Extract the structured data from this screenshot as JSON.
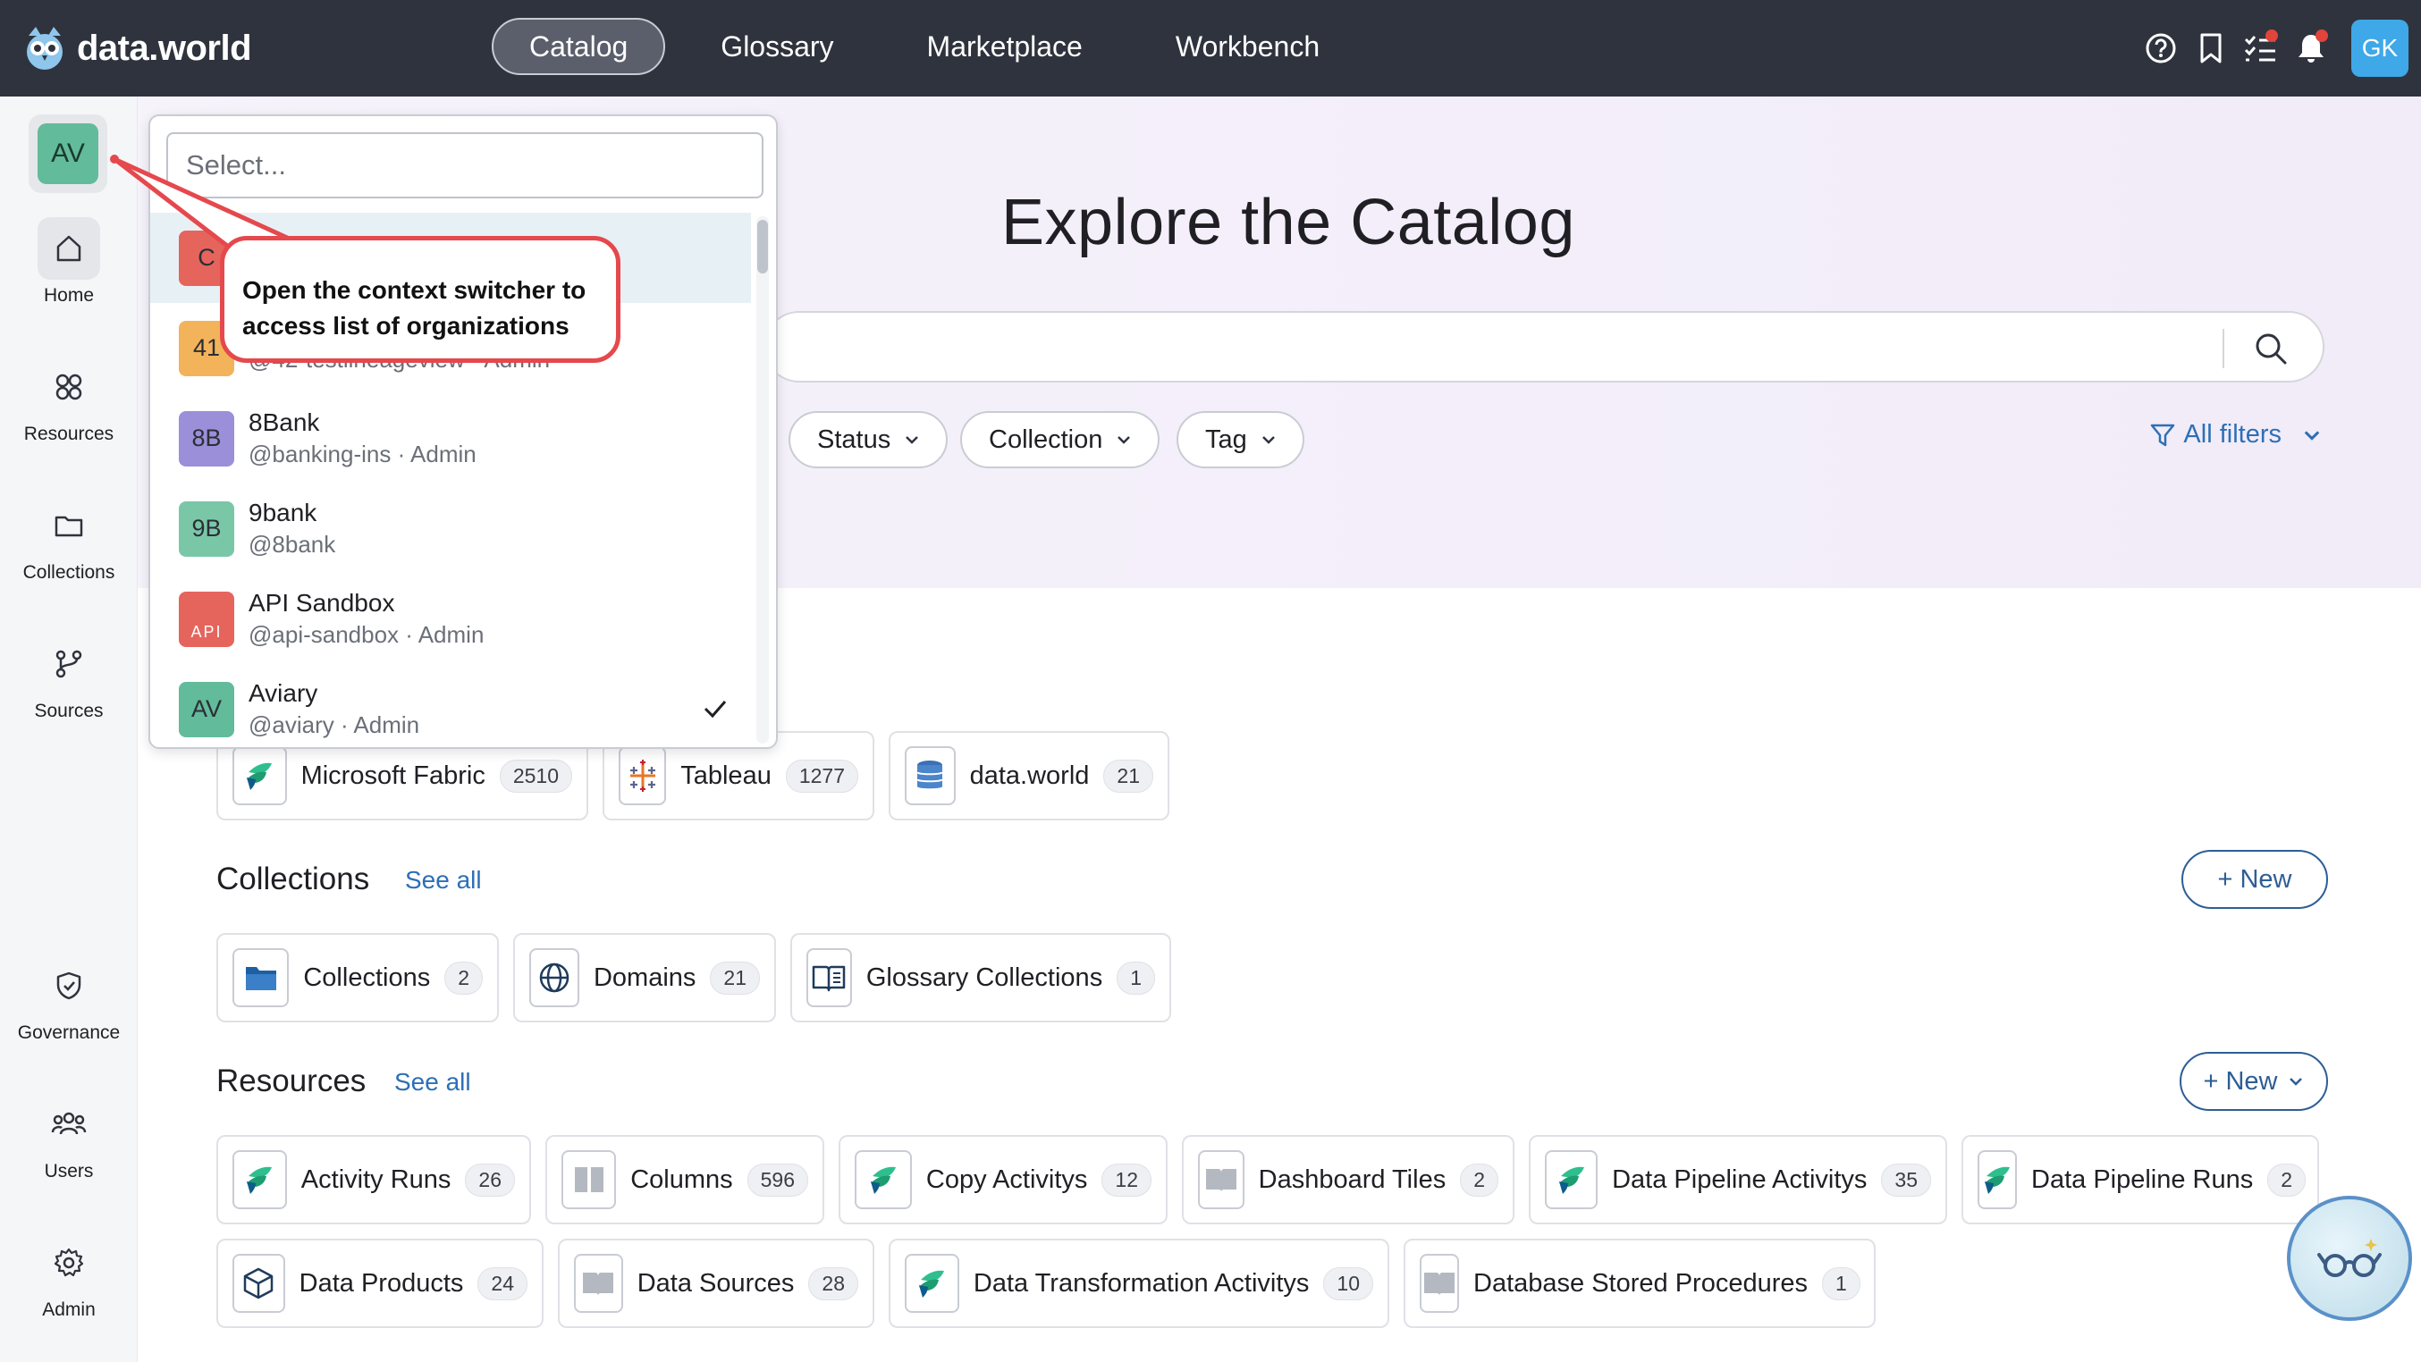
{
  "topbar": {
    "logo_text": "data.world",
    "nav": [
      "Catalog",
      "Glossary",
      "Marketplace",
      "Workbench"
    ],
    "active_nav": "Catalog",
    "user_initials": "GK",
    "icons": [
      "help-icon",
      "bookmark-icon",
      "tasks-icon",
      "bell-icon"
    ]
  },
  "sidebar": {
    "context_initials": "AV",
    "items": [
      {
        "label": "Home",
        "icon": "home-icon"
      },
      {
        "label": "Resources",
        "icon": "resources-icon"
      },
      {
        "label": "Collections",
        "icon": "folder-icon"
      },
      {
        "label": "Sources",
        "icon": "sources-icon"
      },
      {
        "label": "Governance",
        "icon": "shield-icon"
      },
      {
        "label": "Users",
        "icon": "users-icon"
      },
      {
        "label": "Admin",
        "icon": "gear-icon"
      }
    ]
  },
  "hero": {
    "title": "Explore the Catalog",
    "filters": [
      "Status",
      "Collection",
      "Tag"
    ],
    "all_filters": "All filters"
  },
  "sources": [
    {
      "name": "Microsoft Fabric",
      "count": "2510",
      "icon": "fabric-icon"
    },
    {
      "name": "Tableau",
      "count": "1277",
      "icon": "tableau-icon"
    },
    {
      "name": "data.world",
      "count": "21",
      "icon": "database-icon"
    }
  ],
  "collections": {
    "title": "Collections",
    "see_all": "See all",
    "new_label": "+ New",
    "items": [
      {
        "name": "Collections",
        "count": "2",
        "icon": "folder-icon"
      },
      {
        "name": "Domains",
        "count": "21",
        "icon": "globe-icon"
      },
      {
        "name": "Glossary Collections",
        "count": "1",
        "icon": "book-icon"
      }
    ]
  },
  "resources": {
    "title": "Resources",
    "see_all": "See all",
    "new_label": "+ New",
    "row1": [
      {
        "name": "Activity Runs",
        "count": "26",
        "icon": "fabric-icon"
      },
      {
        "name": "Columns",
        "count": "596",
        "icon": "columns-icon"
      },
      {
        "name": "Copy Activitys",
        "count": "12",
        "icon": "fabric-icon"
      },
      {
        "name": "Dashboard Tiles",
        "count": "2",
        "icon": "book-grey-icon"
      },
      {
        "name": "Data Pipeline Activitys",
        "count": "35",
        "icon": "fabric-icon"
      },
      {
        "name": "Data Pipeline Runs",
        "count": "2",
        "icon": "fabric-icon"
      }
    ],
    "row2": [
      {
        "name": "Data Products",
        "count": "24",
        "icon": "cube-icon"
      },
      {
        "name": "Data Sources",
        "count": "28",
        "icon": "book-grey-icon"
      },
      {
        "name": "Data Transformation Activitys",
        "count": "10",
        "icon": "fabric-icon"
      },
      {
        "name": "Database Stored Procedures",
        "count": "1",
        "icon": "book-grey-icon"
      }
    ]
  },
  "dropdown": {
    "placeholder": "Select...",
    "items": [
      {
        "initials": "C",
        "name": "",
        "sub": "",
        "color": "#e5655c"
      },
      {
        "initials": "41",
        "name": "",
        "sub": "@42-testlineageview · Admin",
        "color": "#f2b35a"
      },
      {
        "initials": "8B",
        "name": "8Bank",
        "sub": "@banking-ins · Admin",
        "color": "#9a8fd8"
      },
      {
        "initials": "9B",
        "name": "9bank",
        "sub": "@8bank",
        "color": "#7ac7a8"
      },
      {
        "initials": "API",
        "name": "API Sandbox",
        "sub": "@api-sandbox · Admin",
        "color": "#e5655c"
      },
      {
        "initials": "AV",
        "name": "Aviary",
        "sub": "@aviary · Admin",
        "color": "#62bb9a"
      }
    ]
  },
  "callout": {
    "text": "Open the context switcher to access list of organizations"
  },
  "colors": {
    "topbar": "#2f333d",
    "accent_blue": "#2d6fb6",
    "callout_red": "#e5484d"
  }
}
